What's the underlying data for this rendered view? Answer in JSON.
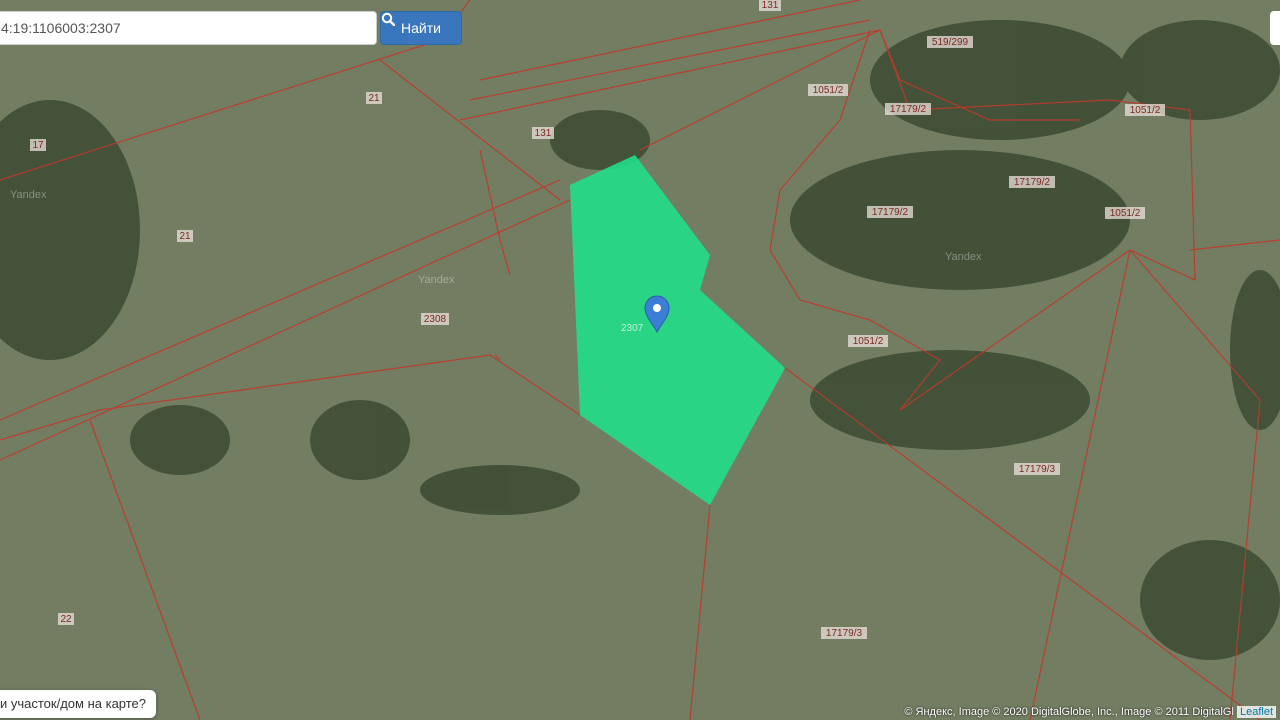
{
  "search": {
    "value": "4:19:1106003:2307",
    "button_label": "Найти",
    "button_icon": "search-icon"
  },
  "help": {
    "text": "и участок/дом на карте?"
  },
  "attribution": {
    "text": "© Яндекс, Image © 2020 DigitalGlobe, Inc., Image © 2011 DigitalGl",
    "leaflet": "Leaflet"
  },
  "map": {
    "watermark": "Yandex",
    "selected_parcel": "2307",
    "parcel_fill_color": "#1fe08a",
    "boundary_color": "#c0392b",
    "marker_color": "#3a7fd5",
    "parcel_labels": [
      "131",
      "131",
      "21",
      "17",
      "21",
      "2308",
      "519/299",
      "1051/2",
      "17179/2",
      "1051/2",
      "17179/2",
      "17179/2",
      "1051/2",
      "1051/2",
      "17179/3",
      "17179/3",
      "22"
    ]
  }
}
